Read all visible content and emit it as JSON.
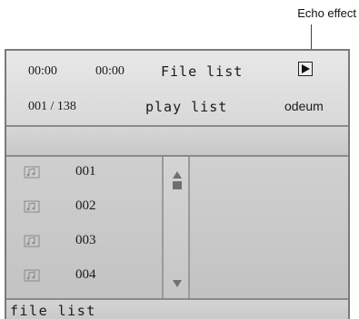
{
  "callout": {
    "label": "Echo effect"
  },
  "header": {
    "elapsed_time": "00:00",
    "total_time": "00:00",
    "mode_tab": "File list",
    "track_counter": "001 / 138",
    "list_tab": "play list",
    "eq_mode": "odeum",
    "play_icon": "play-triangle-icon"
  },
  "list": {
    "items": [
      {
        "number": "001",
        "icon": "music-file-icon"
      },
      {
        "number": "002",
        "icon": "music-file-icon"
      },
      {
        "number": "003",
        "icon": "music-file-icon"
      },
      {
        "number": "004",
        "icon": "music-file-icon"
      }
    ]
  },
  "scrollbar": {
    "up_icon": "scroll-up-arrow-icon",
    "down_icon": "scroll-down-arrow-icon"
  },
  "footer": {
    "label": "file list"
  },
  "colors": {
    "border": "#7a7a7a",
    "text": "#1a1a1a",
    "panel": "#d2d2d2"
  }
}
